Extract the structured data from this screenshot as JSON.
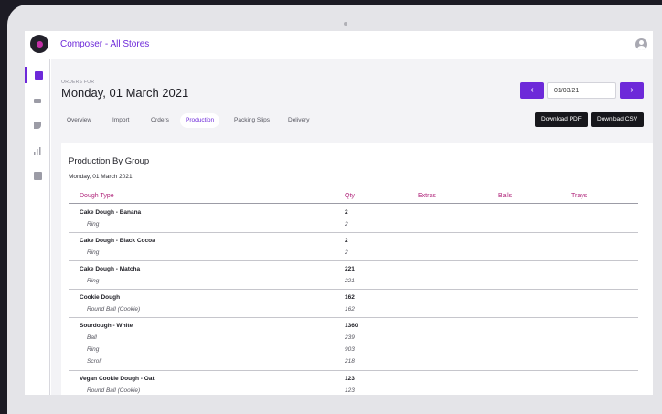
{
  "app": {
    "title": "Composer - All Stores"
  },
  "sidebar": {
    "items": [
      {
        "icon": "orders-icon",
        "active": true
      },
      {
        "icon": "inbox-icon",
        "active": false
      },
      {
        "icon": "mixer-icon",
        "active": false
      },
      {
        "icon": "bar-chart-icon",
        "active": false
      },
      {
        "icon": "list-icon",
        "active": false
      }
    ]
  },
  "header": {
    "orders_for_label": "ORDERS FOR",
    "date_title": "Monday, 01 March 2021",
    "prev_label": "‹",
    "next_label": "›",
    "date_value": "01/03/21"
  },
  "tabs": [
    {
      "label": "Overview",
      "active": false
    },
    {
      "label": "Import",
      "active": false
    },
    {
      "label": "Orders",
      "active": false
    },
    {
      "label": "Production",
      "active": true
    },
    {
      "label": "Packing Slips",
      "active": false
    },
    {
      "label": "Delivery",
      "active": false
    }
  ],
  "actions": {
    "download_pdf": "Download PDF",
    "download_csv": "Download CSV"
  },
  "report": {
    "title": "Production By Group",
    "subtitle": "Monday, 01 March 2021",
    "columns": [
      "Dough Type",
      "Qty",
      "Extras",
      "Balls",
      "Trays"
    ],
    "groups": [
      {
        "name": "Cake Dough - Banana",
        "qty": "2",
        "items": [
          {
            "name": "Ring",
            "qty": "2"
          }
        ]
      },
      {
        "name": "Cake Dough - Black Cocoa",
        "qty": "2",
        "items": [
          {
            "name": "Ring",
            "qty": "2"
          }
        ]
      },
      {
        "name": "Cake Dough - Matcha",
        "qty": "221",
        "items": [
          {
            "name": "Ring",
            "qty": "221"
          }
        ]
      },
      {
        "name": "Cookie Dough",
        "qty": "162",
        "items": [
          {
            "name": "Round Ball (Cookie)",
            "qty": "162"
          }
        ]
      },
      {
        "name": "Sourdough - White",
        "qty": "1360",
        "items": [
          {
            "name": "Ball",
            "qty": "239"
          },
          {
            "name": "Ring",
            "qty": "903"
          },
          {
            "name": "Scroll",
            "qty": "218"
          }
        ]
      },
      {
        "name": "Vegan Cookie Dough - Oat",
        "qty": "123",
        "items": [
          {
            "name": "Round Ball (Cookie)",
            "qty": "123"
          }
        ]
      }
    ]
  },
  "colors": {
    "accent": "#6d29d9",
    "header_text": "#b0247a",
    "dark_button": "#17171c"
  }
}
